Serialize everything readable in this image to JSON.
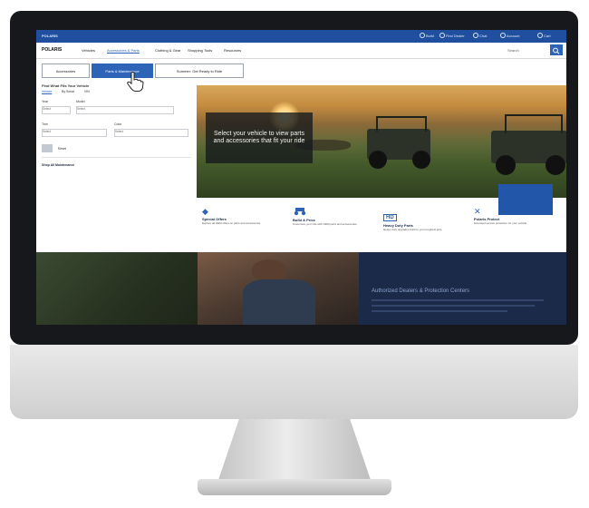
{
  "topbar": {
    "brand": "POLARIS",
    "links": [
      "Build",
      "Find Dealer",
      "Chat",
      "Account",
      "Cart"
    ]
  },
  "nav": {
    "logo": "POLARIS",
    "items": [
      "Vehicles",
      "Accessories & Parts",
      "Clothing & Gear",
      "Shopping Tools",
      "Resources"
    ],
    "search_label": "Search"
  },
  "tabs": {
    "accessories": "Accessories",
    "parts": "Parts & Maintenance",
    "summer": "Summer: Get Ready to Ride"
  },
  "finder": {
    "title": "Find What Fits Your Vehicle",
    "options": [
      "Vehicle",
      "By Serial",
      "VIN"
    ],
    "year_label": "Year",
    "year_value": "Select",
    "model_label": "Model",
    "model_value": "Select",
    "trim_label": "Trim",
    "trim_value": "Select",
    "color_label": "Color",
    "color_value": "Select",
    "reset_label": "Reset",
    "shop_all": "Shop All Maintenance"
  },
  "hero": {
    "message": "Select your vehicle to view parts and accessories that fit your ride"
  },
  "features": [
    {
      "icon": "tag-icon",
      "title": "Special Offers",
      "desc": "Explore all OEM offers on parts and accessories."
    },
    {
      "icon": "atv-icon",
      "title": "Build & Price",
      "desc": "Customize your ride with OEM parts and accessories."
    },
    {
      "icon": "hd-icon",
      "title": "Heavy Duty Parts",
      "desc": "Heavy duty upgrades built for your toughest jobs."
    },
    {
      "icon": "wrench-icon",
      "title": "Polaris Protect",
      "desc": "Extended service protection for your vehicle."
    }
  ],
  "band": {
    "heading": "Authorized Dealers & Protection Centers"
  },
  "colors": {
    "brand_blue": "#1f4f9e",
    "accent_blue": "#2e64b8",
    "navy": "#1c2a4a"
  }
}
